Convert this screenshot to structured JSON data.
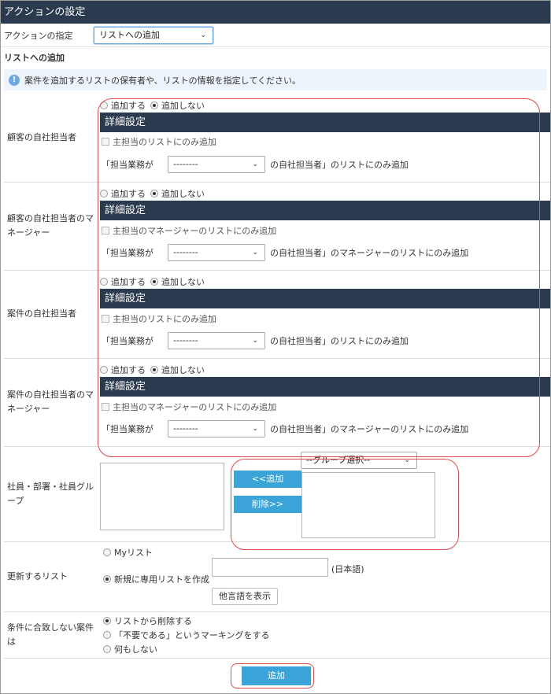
{
  "header": {
    "title": "アクションの設定"
  },
  "action": {
    "label": "アクションの指定",
    "selected": "リストへの追加"
  },
  "subsection": {
    "title": "リストへの追加",
    "info": "案件を追加するリストの保有者や、リストの情報を指定してください。"
  },
  "common": {
    "radio_add": "追加する",
    "radio_no_add": "追加しない",
    "detail_title": "詳細設定",
    "filter_prefix": "「担当業務が",
    "filter_select": "--------"
  },
  "rows": [
    {
      "label": "顧客の自社担当者",
      "check": "主担当のリストにのみ追加",
      "suffix": "の自社担当者」のリストにのみ追加"
    },
    {
      "label": "顧客の自社担当者のマネージャー",
      "check": "主担当のマネージャーのリストにのみ追加",
      "suffix": "の自社担当者」のマネージャーのリストにのみ追加"
    },
    {
      "label": "案件の自社担当者",
      "check": "主担当のリストにのみ追加",
      "suffix": "の自社担当者」のリストにのみ追加"
    },
    {
      "label": "案件の自社担当者のマネージャー",
      "check": "主担当のマネージャーのリストにのみ追加",
      "suffix": "の自社担当者」のマネージャーのリストにのみ追加"
    }
  ],
  "members": {
    "label": "社員・部署・社員グループ",
    "add_button": "<<追加",
    "remove_button": "削除>>",
    "group_select": "--グループ選択--"
  },
  "update_list": {
    "label": "更新するリスト",
    "my_list": "Myリスト",
    "new_list": "新規に専用リストを作成",
    "lang_suffix": "(日本語)",
    "other_lang_button": "他言語を表示"
  },
  "unmatched": {
    "label": "条件に合致しない案件は",
    "options": [
      "リストから削除する",
      "「不要である」というマーキングをする",
      "何もしない"
    ]
  },
  "submit": {
    "label": "追加"
  },
  "colors": {
    "header": "#2b3a4e",
    "button": "#3aa3d8",
    "highlight": "#e04a4a"
  }
}
